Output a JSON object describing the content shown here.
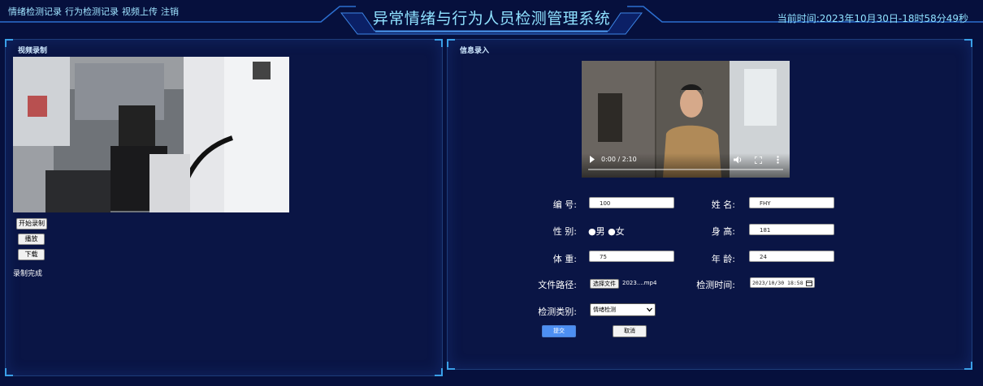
{
  "header": {
    "nav": [
      "情绪检测记录",
      "行为检测记录",
      "视频上传",
      "注销"
    ],
    "title": "异常情绪与行为人员检测管理系统",
    "clock_label": "当前时间:",
    "clock_value": "2023年10月30日-18时58分49秒",
    "accent_color": "#8fe1ff"
  },
  "left_panel": {
    "title": "视频录制",
    "buttons": {
      "start": "开始录制",
      "play": "播放",
      "download": "下载"
    },
    "status": "录制完成"
  },
  "right_panel": {
    "title": "信息录入",
    "player": {
      "time": "0:00 / 2:10"
    },
    "form": {
      "id_label": "编 号:",
      "id_value": "100",
      "name_label": "姓 名:",
      "name_value": "FHY",
      "gender_label": "性 别:",
      "gender_male": "男",
      "gender_female": "女",
      "height_label": "身 高:",
      "height_value": "181",
      "weight_label": "体 重:",
      "weight_value": "75",
      "age_label": "年 龄:",
      "age_value": "24",
      "file_label": "文件路径:",
      "file_button": "选择文件",
      "file_name": "2023....mp4",
      "time_label": "检测时间:",
      "time_value": "2023/10/30 18:58",
      "type_label": "检测类别:",
      "type_value": "情绪检测",
      "submit": "提交",
      "cancel": "取消"
    }
  },
  "icons": [
    "play-icon",
    "volume-icon",
    "fullscreen-icon",
    "more-options-icon",
    "calendar-icon",
    "chevron-down-icon"
  ]
}
